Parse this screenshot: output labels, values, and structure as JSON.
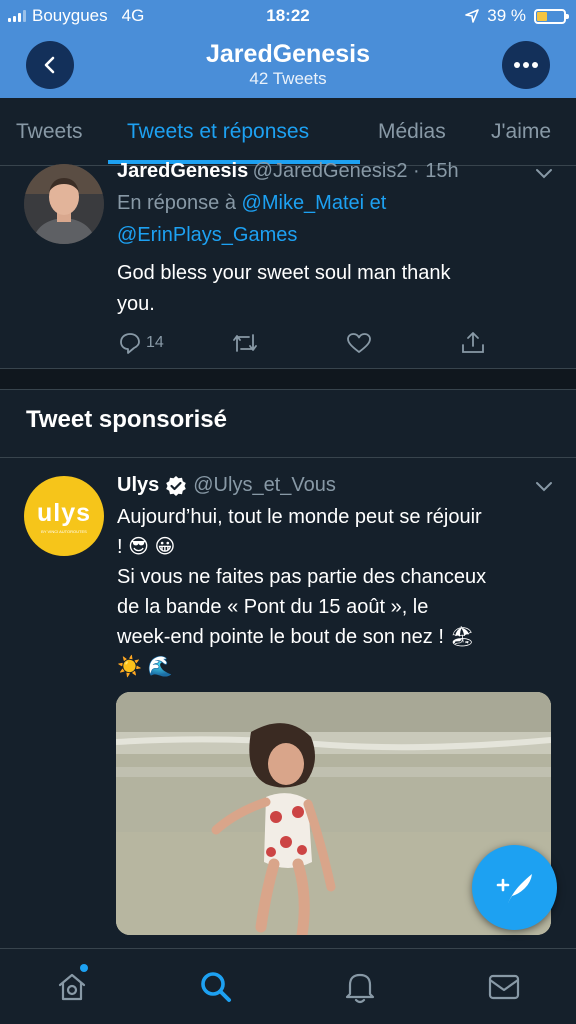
{
  "status_bar": {
    "carrier": "Bouygues",
    "network": "4G",
    "time": "18:22",
    "battery": "39 %",
    "battery_level": 0.39
  },
  "header": {
    "title": "JaredGenesis",
    "subtitle": "42 Tweets"
  },
  "tabs": [
    {
      "label": "Tweets"
    },
    {
      "label": "Tweets et réponses"
    },
    {
      "label": "Médias"
    },
    {
      "label": "J'aime"
    }
  ],
  "tweet1": {
    "name": "JaredGenesis",
    "handle": "@JaredGenesis2 · 15h",
    "reply_prefix": "En réponse à ",
    "reply_to_1": "@Mike_Matei",
    "reply_and": " et",
    "reply_to_2": "@ErinPlays_Games",
    "text_line1": "God bless your sweet soul man thank",
    "text_line2": "you.",
    "reply_count": "14"
  },
  "sponsored": {
    "section_title": "Tweet sponsorisé",
    "name": "Ulys",
    "handle": "@Ulys_et_Vous",
    "avatar_logo": "ulys",
    "avatar_sub": "BY VINCI AUTOROUTES",
    "line1": "Aujourd’hui, tout le monde peut se réjouir",
    "line2": "! 😎 😀",
    "line3": "Si vous ne faites pas partie des chanceux",
    "line4": "de la bande « Pont du 15 août », le",
    "line5": "week-end pointe le bout de son nez ! 🏖",
    "line6": "☀️ 🌊"
  },
  "icons": {
    "back": "chevron-left-icon",
    "more": "more-icon",
    "reply": "reply-icon",
    "retweet": "retweet-icon",
    "like": "heart-icon",
    "share": "share-icon",
    "compose": "compose-icon",
    "home": "home-icon",
    "search": "search-icon",
    "notifications": "bell-icon",
    "messages": "mail-icon"
  },
  "colors": {
    "accent": "#1da1f2",
    "header": "#4a8ed8",
    "background": "#15202b"
  }
}
